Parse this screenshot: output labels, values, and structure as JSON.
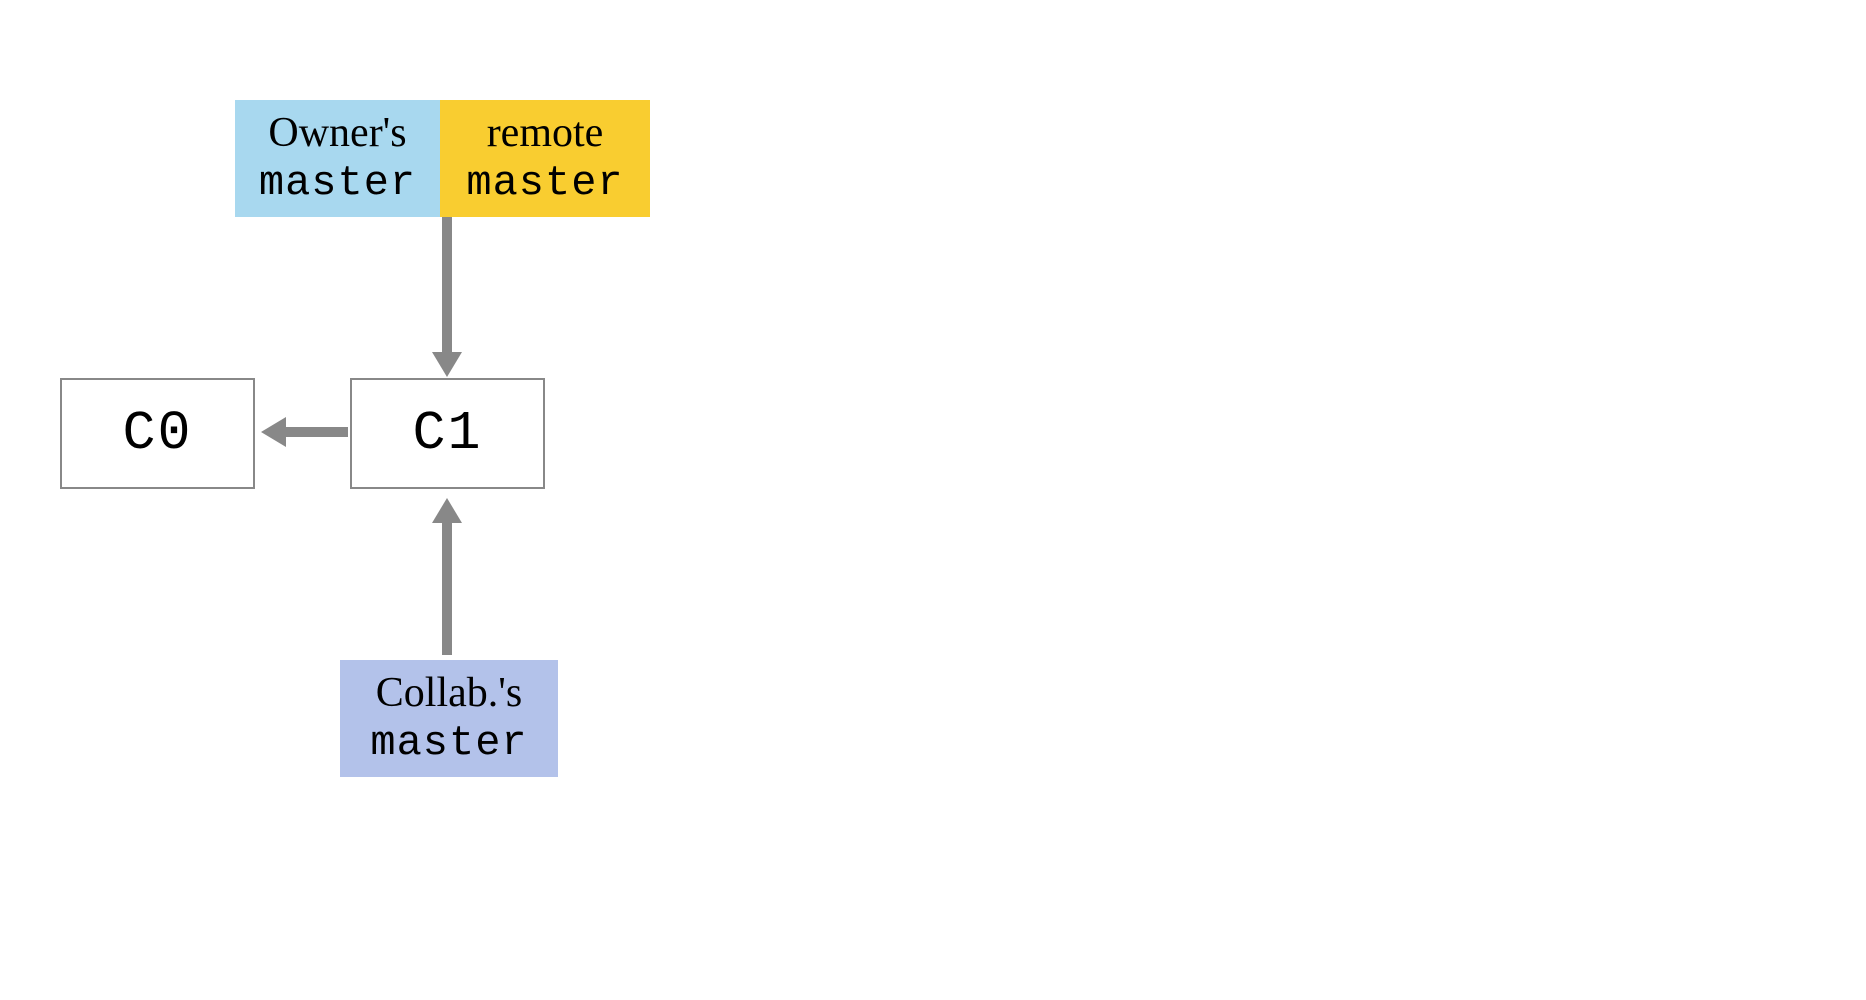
{
  "branches": {
    "owner": {
      "title": "Owner's",
      "name": "master",
      "color": "#a8d8ef"
    },
    "remote": {
      "title": "remote",
      "name": "master",
      "color": "#f9cd30"
    },
    "collab": {
      "title": "Collab.'s",
      "name": "master",
      "color": "#b3c2ea"
    }
  },
  "commits": {
    "c0": {
      "label": "C0"
    },
    "c1": {
      "label": "C1"
    }
  },
  "arrows": {
    "color": "#888888"
  }
}
